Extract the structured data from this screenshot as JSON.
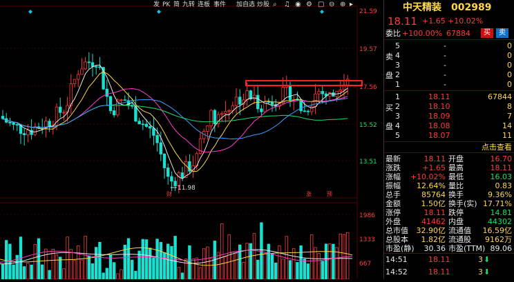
{
  "toolbar": {
    "items": [
      "发",
      "PK",
      "简",
      "九转",
      "连板",
      "事件",
      "加自选",
      "炒股",
      "画线"
    ]
  },
  "axis": {
    "price_ticks": [
      "21.59",
      "19.57",
      "17.56",
      "15.52",
      "13.51"
    ],
    "volume_ticks": [
      "1986",
      "1333",
      "667"
    ],
    "low_label": "11.98",
    "markers": [
      "财",
      "涨",
      "预"
    ]
  },
  "stock": {
    "name": "中天精装",
    "code": "002989",
    "price": "18.11",
    "change": "+1.65",
    "change_pct": "+10.02%"
  },
  "weibi": {
    "label": "委比",
    "ratio": "+100.00%",
    "diff": "67884",
    "buy_btn": "买",
    "sell_btn": "卖"
  },
  "asks": [
    {
      "level": "5",
      "price": "-",
      "vol": "0"
    },
    {
      "level": "4",
      "price": "-",
      "vol": "0"
    },
    {
      "level": "3",
      "price": "-",
      "vol": "0"
    },
    {
      "level": "2",
      "price": "-",
      "vol": "0"
    },
    {
      "level": "1",
      "price": "-",
      "vol": "0"
    }
  ],
  "ask_side_label": [
    "卖",
    "盘"
  ],
  "bids": [
    {
      "level": "1",
      "price": "18.11",
      "vol": "67844"
    },
    {
      "level": "2",
      "price": "18.10",
      "vol": "8"
    },
    {
      "level": "3",
      "price": "18.09",
      "vol": "7"
    },
    {
      "level": "4",
      "price": "18.08",
      "vol": "14"
    },
    {
      "level": "5",
      "price": "18.07",
      "vol": "11"
    }
  ],
  "bid_side_label": [
    "买",
    "盘"
  ],
  "click_more": "点击查看",
  "quote": [
    {
      "l1": "最新",
      "v1": "18.11",
      "l2": "开盘",
      "v2": "16.70",
      "c1": "red",
      "c2": "red"
    },
    {
      "l1": "涨跌",
      "v1": "+1.65",
      "l2": "最高",
      "v2": "18.11",
      "c1": "red",
      "c2": "red"
    },
    {
      "l1": "涨幅",
      "v1": "+10.02%",
      "l2": "最低",
      "v2": "16.03",
      "c1": "red",
      "c2": "grn"
    },
    {
      "l1": "振幅",
      "v1": "12.64%",
      "l2": "量比",
      "v2": "0.83",
      "c1": "yel",
      "c2": "yel"
    },
    {
      "l1": "总手",
      "v1": "85764",
      "l2": "换手",
      "v2": "9.36%",
      "c1": "yel",
      "c2": "yel"
    },
    {
      "l1": "金额",
      "v1": "1.50亿",
      "l2": "换手(实)",
      "v2": "17.71%",
      "c1": "yel",
      "c2": "yel"
    },
    {
      "l1": "涨停",
      "v1": "18.11",
      "l2": "跌停",
      "v2": "14.81",
      "c1": "red",
      "c2": "grn"
    },
    {
      "l1": "外盘",
      "v1": "41462",
      "l2": "内盘",
      "v2": "44302",
      "c1": "red",
      "c2": "grn"
    },
    {
      "l1": "总市值",
      "v1": "32.90亿",
      "l2": "流通值",
      "v2": "16.59亿",
      "c1": "yel",
      "c2": "yel"
    },
    {
      "l1": "总股本",
      "v1": "1.82亿",
      "l2": "流通股",
      "v2": "9162万",
      "c1": "yel",
      "c2": "yel"
    },
    {
      "l1": "市盈(静)",
      "v1": "30.36",
      "l2": "市盈(TTM)",
      "v2": "89.06",
      "c1": "wht",
      "c2": "wht"
    }
  ],
  "ticks": [
    {
      "time": "14:51",
      "price": "18.11",
      "vol": "3"
    },
    {
      "time": "14:52",
      "price": "18.11",
      "vol": "3"
    }
  ],
  "colors": {
    "up": "#ff3b3b",
    "down": "#19e0d0",
    "ma5": "#e8e8e8",
    "ma10": "#ffd84a",
    "ma20": "#ff3bd0",
    "ma60": "#19e06a"
  }
}
